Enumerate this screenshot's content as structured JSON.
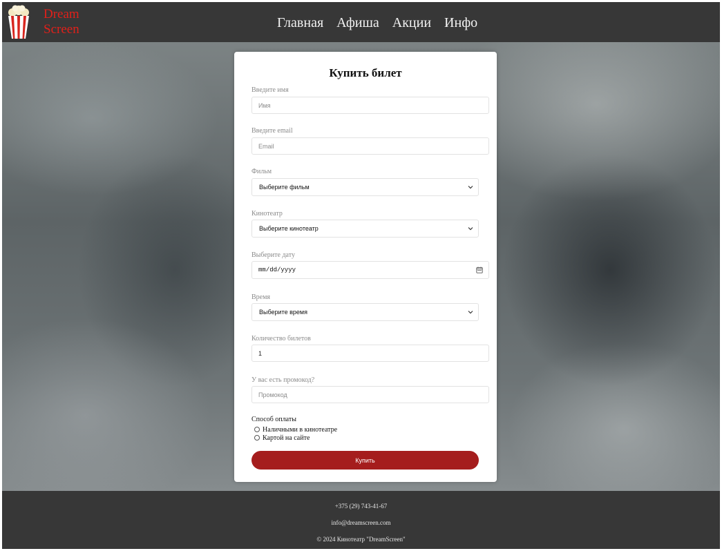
{
  "header": {
    "logo": {
      "line1": "Dream",
      "line2": "Screen"
    },
    "nav": [
      {
        "label": "Главная"
      },
      {
        "label": "Афиша"
      },
      {
        "label": "Акции"
      },
      {
        "label": "Инфо"
      }
    ]
  },
  "form": {
    "title": "Купить билет",
    "name": {
      "label": "Введите имя",
      "placeholder": "Имя",
      "value": ""
    },
    "email": {
      "label": "Введите email",
      "placeholder": "Email",
      "value": ""
    },
    "film": {
      "label": "Фильм",
      "selected": "Выберите фильм"
    },
    "cinema": {
      "label": "Кинотеатр",
      "selected": "Выберите кинотеатр"
    },
    "date": {
      "label": "Выберите дату",
      "value": "mm/dd/yyyy"
    },
    "time": {
      "label": "Время",
      "selected": "Выберите время"
    },
    "quantity": {
      "label": "Количество билетов",
      "value": "1"
    },
    "promo": {
      "label": "У вас есть промокод?",
      "placeholder": "Промокод",
      "value": ""
    },
    "payment": {
      "title": "Способ оплаты",
      "options": [
        {
          "label": "Наличными в кинотеатре",
          "checked": false
        },
        {
          "label": "Картой на сайте",
          "checked": false
        }
      ]
    },
    "submit_label": "Купить"
  },
  "footer": {
    "phone": "+375 (29) 743-41-67",
    "email": "info@dreamscreen.com",
    "copyright": "© 2024 Кинотеатр \"DreamScreen\""
  },
  "icons": {
    "logo": "popcorn-icon",
    "select_arrow": "chevron-down-icon",
    "date_picker": "calendar-icon"
  },
  "colors": {
    "header_bg": "#373737",
    "logo_text": "#e0201a",
    "button_bg": "#a51d1d",
    "card_bg": "#ffffff",
    "footer_bg": "#373737"
  }
}
